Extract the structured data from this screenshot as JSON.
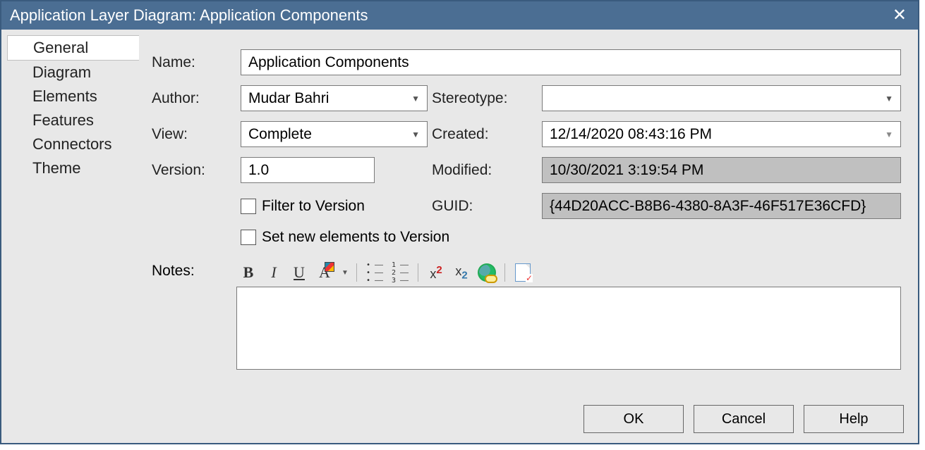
{
  "title": "Application Layer Diagram: Application Components",
  "sidebar": {
    "items": [
      {
        "label": "General"
      },
      {
        "label": "Diagram"
      },
      {
        "label": "Elements"
      },
      {
        "label": "Features"
      },
      {
        "label": "Connectors"
      },
      {
        "label": "Theme"
      }
    ]
  },
  "labels": {
    "name": "Name:",
    "author": "Author:",
    "view": "View:",
    "version": "Version:",
    "stereotype": "Stereotype:",
    "created": "Created:",
    "modified": "Modified:",
    "guid": "GUID:",
    "filter_to_version": "Filter to Version",
    "set_new_elements": "Set new elements to Version",
    "notes": "Notes:"
  },
  "fields": {
    "name": "Application Components",
    "author": "Mudar Bahri",
    "view": "Complete",
    "version": "1.0",
    "stereotype": "",
    "created": "12/14/2020 08:43:16 PM",
    "modified": "10/30/2021 3:19:54 PM",
    "guid": "{44D20ACC-B8B6-4380-8A3F-46F517E36CFD}"
  },
  "buttons": {
    "ok": "OK",
    "cancel": "Cancel",
    "help": "Help"
  }
}
